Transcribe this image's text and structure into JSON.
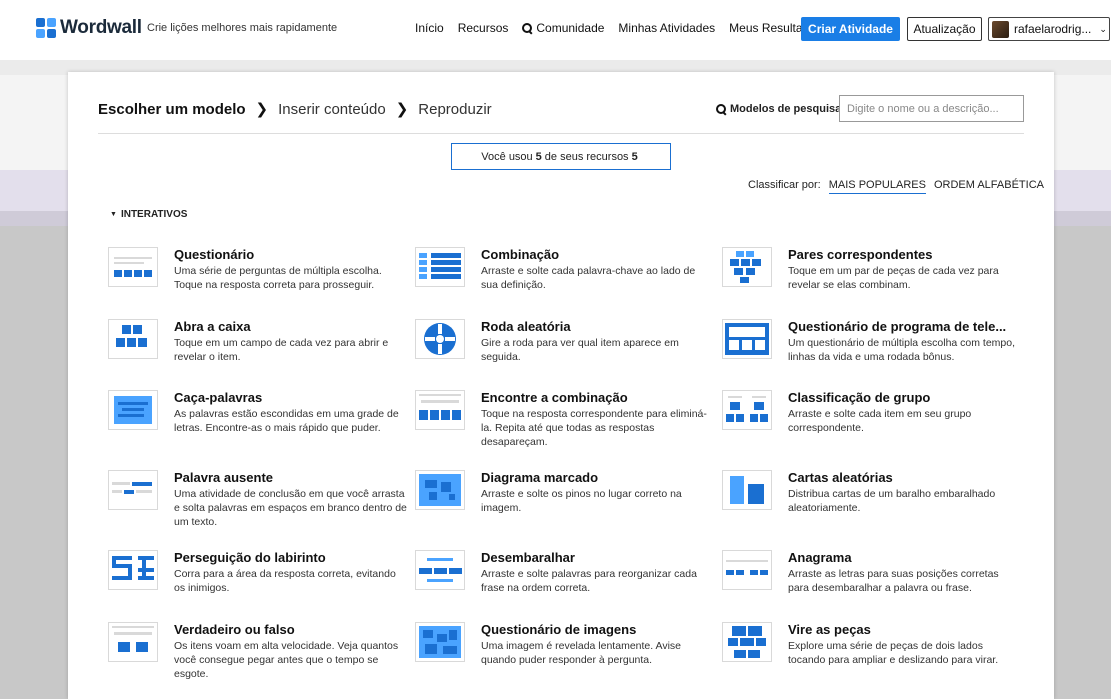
{
  "topbar": {
    "logo": "Wordwall",
    "tagline": "Crie lições melhores mais rapidamente",
    "nav": [
      "Início",
      "Recursos",
      "Comunidade",
      "Minhas Atividades",
      "Meus Resultados"
    ],
    "create_button": "Criar Atividade",
    "upgrade_button": "Atualização",
    "user_name": "rafaelarodrig...",
    "accent": "#1a7ee6"
  },
  "breadcrumb": {
    "step1": "Escolher um modelo",
    "step2": "Inserir conteúdo",
    "step3": "Reproduzir"
  },
  "search": {
    "label": "Modelos de pesquisa:",
    "placeholder": "Digite o nome ou a descrição..."
  },
  "usage": {
    "prefix": "Você usou",
    "used": "5",
    "mid": "de seus recursos",
    "total": "5"
  },
  "sort": {
    "label": "Classificar por:",
    "option1": "MAIS POPULARES",
    "option2": "ORDEM ALFABÉTICA"
  },
  "section": "INTERATIVOS",
  "templates": [
    {
      "title": "Questionário",
      "desc": "Uma série de perguntas de múltipla escolha. Toque na resposta correta para prosseguir.",
      "icon": "quiz-icon"
    },
    {
      "title": "Combinação",
      "desc": "Arraste e solte cada palavra-chave ao lado de sua definição.",
      "icon": "match-up-icon"
    },
    {
      "title": "Pares correspondentes",
      "desc": "Toque em um par de peças de cada vez para revelar se elas combinam.",
      "icon": "matching-pairs-icon"
    },
    {
      "title": "Abra a caixa",
      "desc": "Toque em um campo de cada vez para abrir e revelar o item.",
      "icon": "open-box-icon"
    },
    {
      "title": "Roda aleatória",
      "desc": "Gire a roda para ver qual item aparece em seguida.",
      "icon": "random-wheel-icon"
    },
    {
      "title": "Questionário de programa de tele...",
      "desc": "Um questionário de múltipla escolha com tempo, linhas da vida e uma rodada bônus.",
      "icon": "gameshow-quiz-icon"
    },
    {
      "title": "Caça-palavras",
      "desc": "As palavras estão escondidas em uma grade de letras. Encontre-as o mais rápido que puder.",
      "icon": "wordsearch-icon"
    },
    {
      "title": "Encontre a combinação",
      "desc": "Toque na resposta correspondente para eliminá-la. Repita até que todas as respostas desapareçam.",
      "icon": "find-match-icon"
    },
    {
      "title": "Classificação de grupo",
      "desc": "Arraste e solte cada item em seu grupo correspondente.",
      "icon": "group-sort-icon"
    },
    {
      "title": "Palavra ausente",
      "desc": "Uma atividade de conclusão em que você arrasta e solta palavras em espaços em branco dentro de um texto.",
      "icon": "missing-word-icon"
    },
    {
      "title": "Diagrama marcado",
      "desc": "Arraste e solte os pinos no lugar correto na imagem.",
      "icon": "labelled-diagram-icon"
    },
    {
      "title": "Cartas aleatórias",
      "desc": "Distribua cartas de um baralho embaralhado aleatoriamente.",
      "icon": "random-cards-icon"
    },
    {
      "title": "Perseguição do labirinto",
      "desc": "Corra para a área da resposta correta, evitando os inimigos.",
      "icon": "maze-chase-icon"
    },
    {
      "title": "Desembaralhar",
      "desc": "Arraste e solte palavras para reorganizar cada frase na ordem correta.",
      "icon": "unjumble-icon"
    },
    {
      "title": "Anagrama",
      "desc": "Arraste as letras para suas posições corretas para desembaralhar a palavra ou frase.",
      "icon": "anagram-icon"
    },
    {
      "title": "Verdadeiro ou falso",
      "desc": "Os itens voam em alta velocidade. Veja quantos você consegue pegar antes que o tempo se esgote.",
      "icon": "true-false-icon"
    },
    {
      "title": "Questionário de imagens",
      "desc": "Uma imagem é revelada lentamente. Avise quando puder responder à pergunta.",
      "icon": "image-quiz-icon"
    },
    {
      "title": "Vire as peças",
      "desc": "Explore uma série de peças de dois lados tocando para ampliar e deslizando para virar.",
      "icon": "flip-tiles-icon"
    }
  ]
}
